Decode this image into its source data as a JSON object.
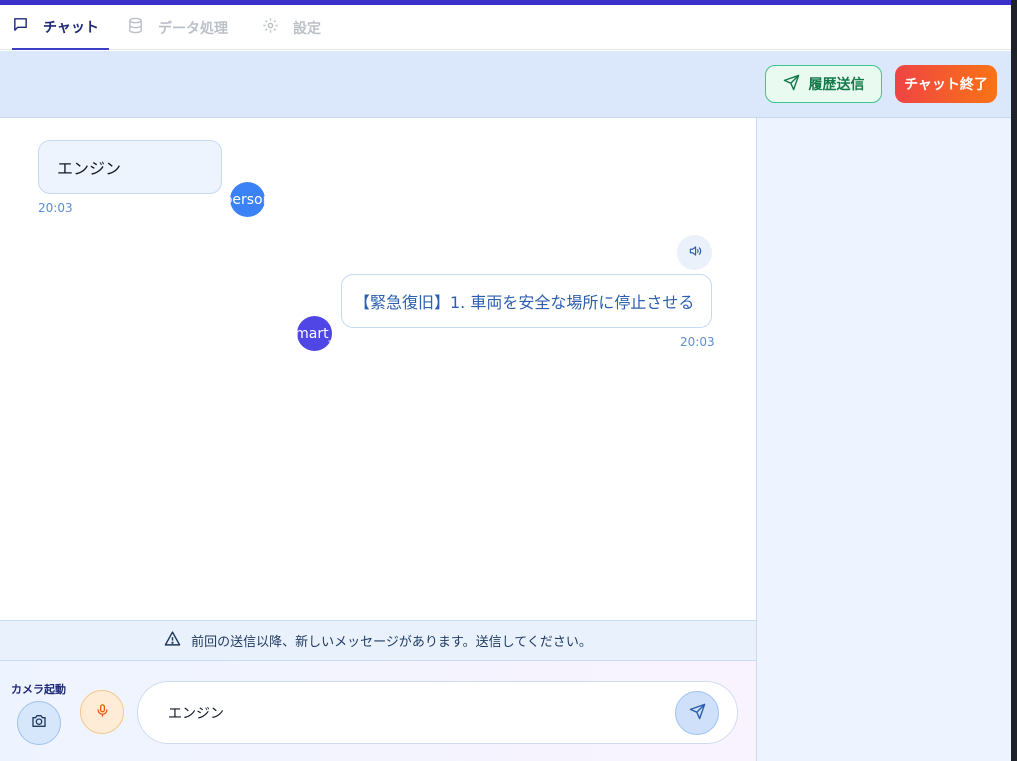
{
  "tabs": [
    {
      "label": "チャット",
      "icon": "chat-bubble-icon",
      "active": true
    },
    {
      "label": "データ処理",
      "icon": "database-icon",
      "active": false
    },
    {
      "label": "設定",
      "icon": "gear-icon",
      "active": false
    }
  ],
  "header": {
    "history_label": "履歴送信",
    "end_label": "チャット終了"
  },
  "messages": [
    {
      "role": "user",
      "text": "エンジン",
      "time": "20:03",
      "avatar": "person"
    },
    {
      "role": "bot",
      "text": "【緊急復旧】1. 車両を安全な場所に停止させる",
      "time": "20:03",
      "avatar": "smart_t"
    }
  ],
  "notice": {
    "text": "前回の送信以降、新しいメッセージがあります。送信してください。",
    "icon": "warning-icon"
  },
  "input": {
    "camera_label": "カメラ起動",
    "value": "エンジン"
  },
  "colors": {
    "accent": "#3b30c9",
    "end_button_start": "#ef4444",
    "end_button_end": "#f97316",
    "history_button": "#147a4a"
  }
}
